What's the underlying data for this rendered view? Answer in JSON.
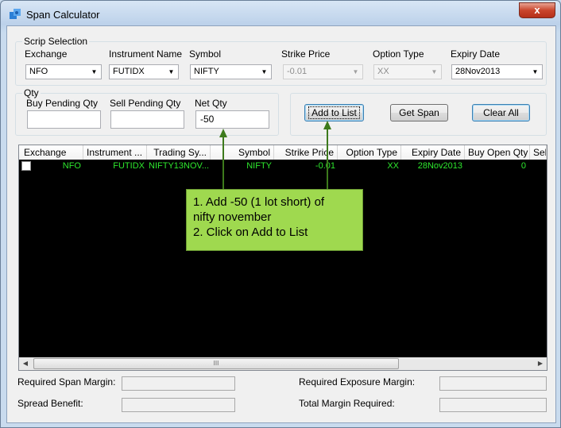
{
  "window": {
    "title": "Span Calculator",
    "close_glyph": "x",
    "icon": "puzzle-icon"
  },
  "scrip": {
    "group_label": "Scrip Selection",
    "exchange_label": "Exchange",
    "exchange_value": "NFO",
    "instrument_label": "Instrument Name",
    "instrument_value": "FUTIDX",
    "symbol_label": "Symbol",
    "symbol_value": "NIFTY",
    "strike_label": "Strike Price",
    "strike_value": "-0.01",
    "option_type_label": "Option Type",
    "option_type_value": "XX",
    "expiry_label": "Expiry Date",
    "expiry_value": "28Nov2013"
  },
  "qty": {
    "group_label": "Qty",
    "buy_pending_label": "Buy Pending Qty",
    "buy_pending_value": "",
    "sell_pending_label": "Sell Pending Qty",
    "sell_pending_value": "",
    "net_label": "Net Qty",
    "net_value": "-50"
  },
  "buttons": {
    "add_to_list": "Add to List",
    "get_span": "Get Span",
    "clear_all": "Clear All"
  },
  "grid": {
    "columns": [
      "Exchange",
      "Instrument ...",
      "Trading Sy...",
      "Symbol",
      "Strike Price",
      "Option Type",
      "Expiry Date",
      "Buy Open Qty",
      "Sel"
    ],
    "rows": [
      [
        "NFO",
        "FUTIDX",
        "NIFTY13NOV...",
        "NIFTY",
        "-0.01",
        "XX",
        "28Nov2013",
        "0",
        ""
      ]
    ],
    "scroll_thumb_glyph": "III"
  },
  "annotation": {
    "line1": "1. Add -50 (1 lot short) of",
    "line2": "nifty november",
    "line3": "2. Click on Add to List"
  },
  "summary": {
    "span_margin_label": "Required Span Margin:",
    "spread_benefit_label": "Spread Benefit:",
    "exposure_margin_label": "Required Exposure Margin:",
    "total_margin_label": "Total Margin Required:"
  },
  "colors": {
    "grid_text": "#2ee82e",
    "note_bg": "#9fd94f",
    "arrow": "#3d7a1c"
  }
}
